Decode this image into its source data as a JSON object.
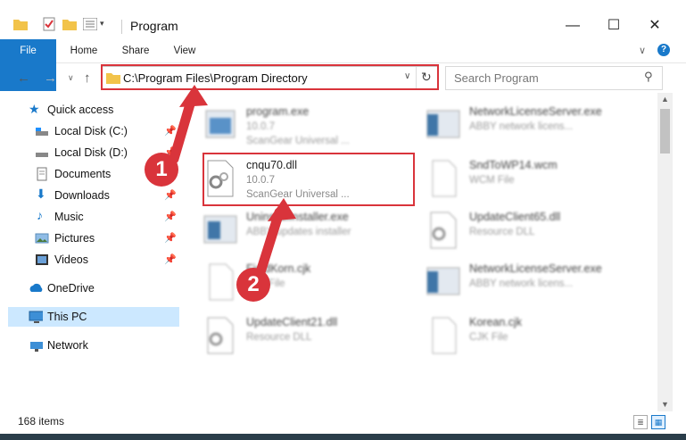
{
  "window": {
    "title": "Program"
  },
  "ribbon": {
    "tabs": [
      "File",
      "Home",
      "Share",
      "View"
    ]
  },
  "address": {
    "path": "C:\\Program Files\\Program Directory"
  },
  "search": {
    "placeholder": "Search Program"
  },
  "sidebar": {
    "items": [
      {
        "label": "Quick access",
        "icon": "star-icon",
        "pinned": false
      },
      {
        "label": "Local Disk (C:)",
        "icon": "drive-icon",
        "pinned": true
      },
      {
        "label": "Local Disk (D:)",
        "icon": "drive-icon",
        "pinned": true
      },
      {
        "label": "Documents",
        "icon": "documents-icon",
        "pinned": true
      },
      {
        "label": "Downloads",
        "icon": "downloads-icon",
        "pinned": true
      },
      {
        "label": "Music",
        "icon": "music-icon",
        "pinned": true
      },
      {
        "label": "Pictures",
        "icon": "pictures-icon",
        "pinned": true
      },
      {
        "label": "Videos",
        "icon": "videos-icon",
        "pinned": true
      },
      {
        "label": "OneDrive",
        "icon": "onedrive-icon",
        "pinned": false
      },
      {
        "label": "This PC",
        "icon": "this-pc-icon",
        "pinned": false,
        "selected": true
      },
      {
        "label": "Network",
        "icon": "network-icon",
        "pinned": false
      }
    ]
  },
  "files": [
    {
      "name": "program.exe",
      "line2": "10.0.7",
      "line3": "ScanGear Universal ...",
      "kind": "exe",
      "blurred": true
    },
    {
      "name": "NetworkLicenseServer.exe",
      "line2": "ABBY network licens...",
      "line3": "",
      "kind": "exe",
      "blurred": true
    },
    {
      "name": "cnqu70.dll",
      "line2": "10.0.7",
      "line3": "ScanGear Universal ...",
      "kind": "dll",
      "blurred": false,
      "highlighted": true
    },
    {
      "name": "SndToWP14.wcm",
      "line2": "WCM File",
      "line3": "",
      "kind": "doc",
      "blurred": true
    },
    {
      "name": "UninstallInstaller.exe",
      "line2": "ABBY updates installer",
      "line3": "",
      "kind": "exe",
      "blurred": true
    },
    {
      "name": "UpdateClient65.dll",
      "line2": "Resource DLL",
      "line3": "",
      "kind": "dll",
      "blurred": true
    },
    {
      "name": "FieldKorn.cjk",
      "line2": "CJK File",
      "line3": "",
      "kind": "doc",
      "blurred": true
    },
    {
      "name": "NetworkLicenseServer.exe",
      "line2": "ABBY network licens...",
      "line3": "",
      "kind": "exe",
      "blurred": true
    },
    {
      "name": "UpdateClient21.dll",
      "line2": "Resource DLL",
      "line3": "",
      "kind": "dll",
      "blurred": true
    },
    {
      "name": "Korean.cjk",
      "line2": "CJK File",
      "line3": "",
      "kind": "doc",
      "blurred": true
    }
  ],
  "status": {
    "item_count": "168 items"
  },
  "annotations": [
    "1",
    "2"
  ],
  "colors": {
    "accent": "#1979ca",
    "highlight": "#d9343b",
    "selected": "#cce8ff"
  }
}
